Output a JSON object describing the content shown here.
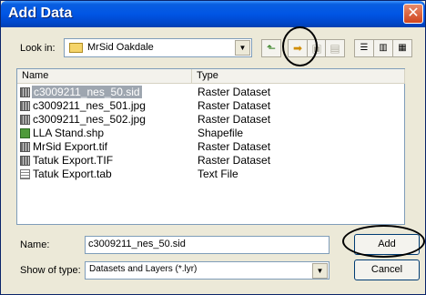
{
  "window": {
    "title": "Add Data",
    "close_label": "✕"
  },
  "toolbar": {
    "look_in_label": "Look in:",
    "look_in_value": "MrSid Oakdale",
    "buttons": [
      {
        "name": "up-one-level",
        "icon": "up-folder-icon"
      },
      {
        "name": "connect-to-folder",
        "icon": "connect-folder-icon"
      },
      {
        "name": "disconnect-folder",
        "icon": "disconnect-folder-icon"
      },
      {
        "name": "delete",
        "icon": "delete-icon"
      },
      {
        "name": "list-view",
        "icon": "list-view-icon"
      },
      {
        "name": "details-view",
        "icon": "details-view-icon"
      },
      {
        "name": "thumbnails-view",
        "icon": "thumbnails-view-icon"
      }
    ]
  },
  "file_list": {
    "columns": [
      "Name",
      "Type"
    ],
    "rows": [
      {
        "name": "c3009211_nes_50.sid",
        "type": "Raster Dataset",
        "icon": "raster",
        "selected": true
      },
      {
        "name": "c3009211_nes_501.jpg",
        "type": "Raster Dataset",
        "icon": "raster",
        "selected": false
      },
      {
        "name": "c3009211_nes_502.jpg",
        "type": "Raster Dataset",
        "icon": "raster",
        "selected": false
      },
      {
        "name": "LLA Stand.shp",
        "type": "Shapefile",
        "icon": "shape",
        "selected": false
      },
      {
        "name": "MrSid Export.tif",
        "type": "Raster Dataset",
        "icon": "raster",
        "selected": false
      },
      {
        "name": "Tatuk Export.TIF",
        "type": "Raster Dataset",
        "icon": "raster",
        "selected": false
      },
      {
        "name": "Tatuk Export.tab",
        "type": "Text File",
        "icon": "text",
        "selected": false
      }
    ]
  },
  "footer": {
    "name_label": "Name:",
    "name_value": "c3009211_nes_50.sid",
    "show_type_label": "Show of type:",
    "show_type_value": "Datasets and Layers (*.lyr)",
    "add_label": "Add",
    "cancel_label": "Cancel"
  },
  "colors": {
    "title_bar": "#0055E5",
    "selection": "#9EA6B0",
    "face": "#ECE9D8"
  }
}
